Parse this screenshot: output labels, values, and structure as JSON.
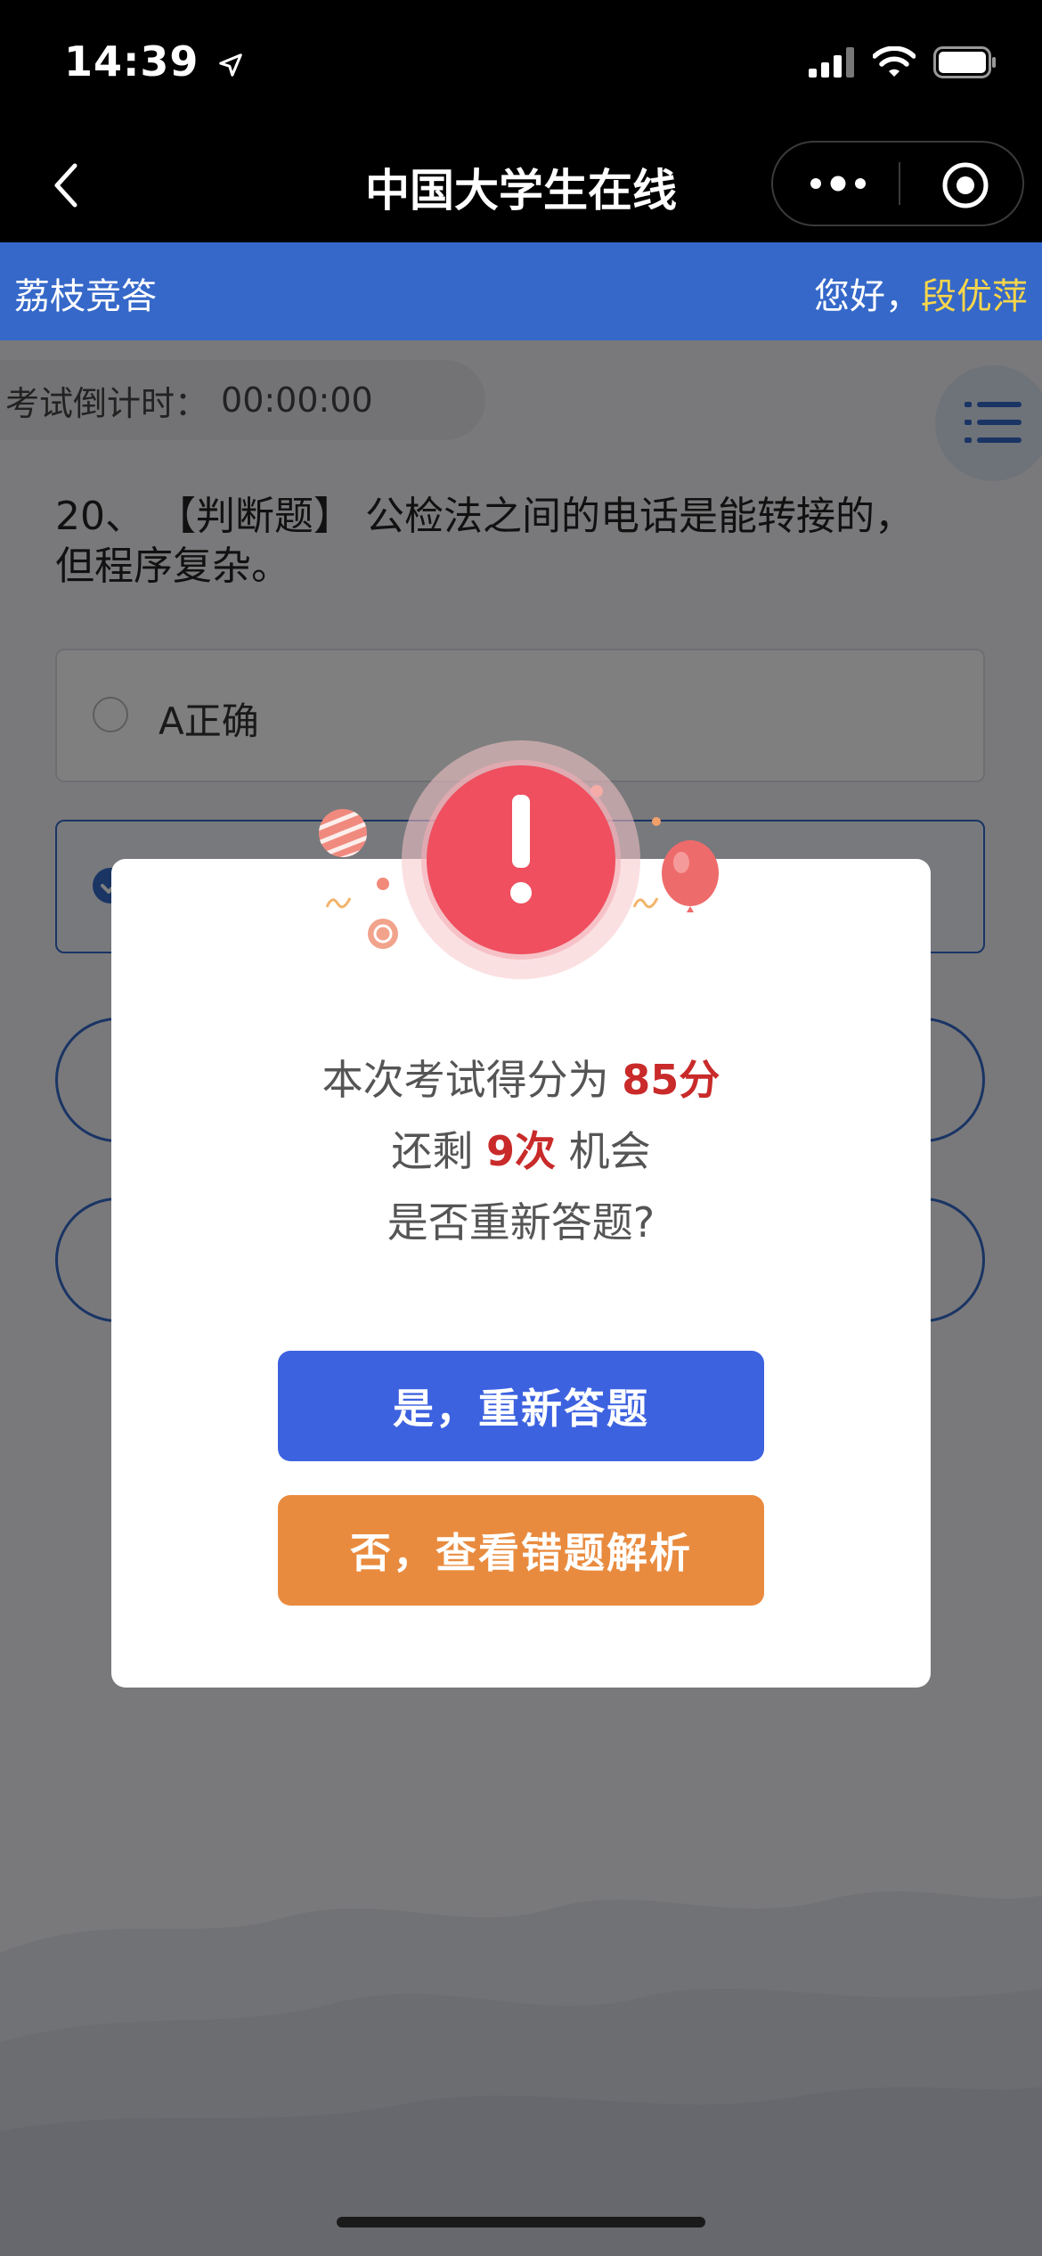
{
  "status_bar": {
    "time": "14:39"
  },
  "nav": {
    "title": "中国大学生在线"
  },
  "app_header": {
    "name": "荔枝竞答",
    "greeting": "您好，",
    "user_name": "段优萍"
  },
  "exam": {
    "timer_label": "考试倒计时：",
    "timer_value": "00:00:00",
    "question": "20、 【判断题】 公检法之间的电话是能转接的，但程序复杂。",
    "options": [
      {
        "label": "A正确",
        "selected": false
      },
      {
        "label": "",
        "selected": true
      }
    ]
  },
  "dialog": {
    "line1_prefix": "本次考试得分为 ",
    "score": "85分",
    "line2_prefix": "还剩 ",
    "chances": "9次",
    "line2_suffix": " 机会",
    "line3": "是否重新答题?",
    "retry_button": "是，重新答题",
    "review_button": "否，查看错题解析",
    "alert_symbol": "!"
  },
  "colors": {
    "header_blue": "#3568c9",
    "user_yellow": "#f8d64b",
    "score_red": "#c92a2a",
    "retry_blue": "#3d62e0",
    "review_orange": "#e98b3f",
    "alert_red": "#ef4f5f"
  }
}
